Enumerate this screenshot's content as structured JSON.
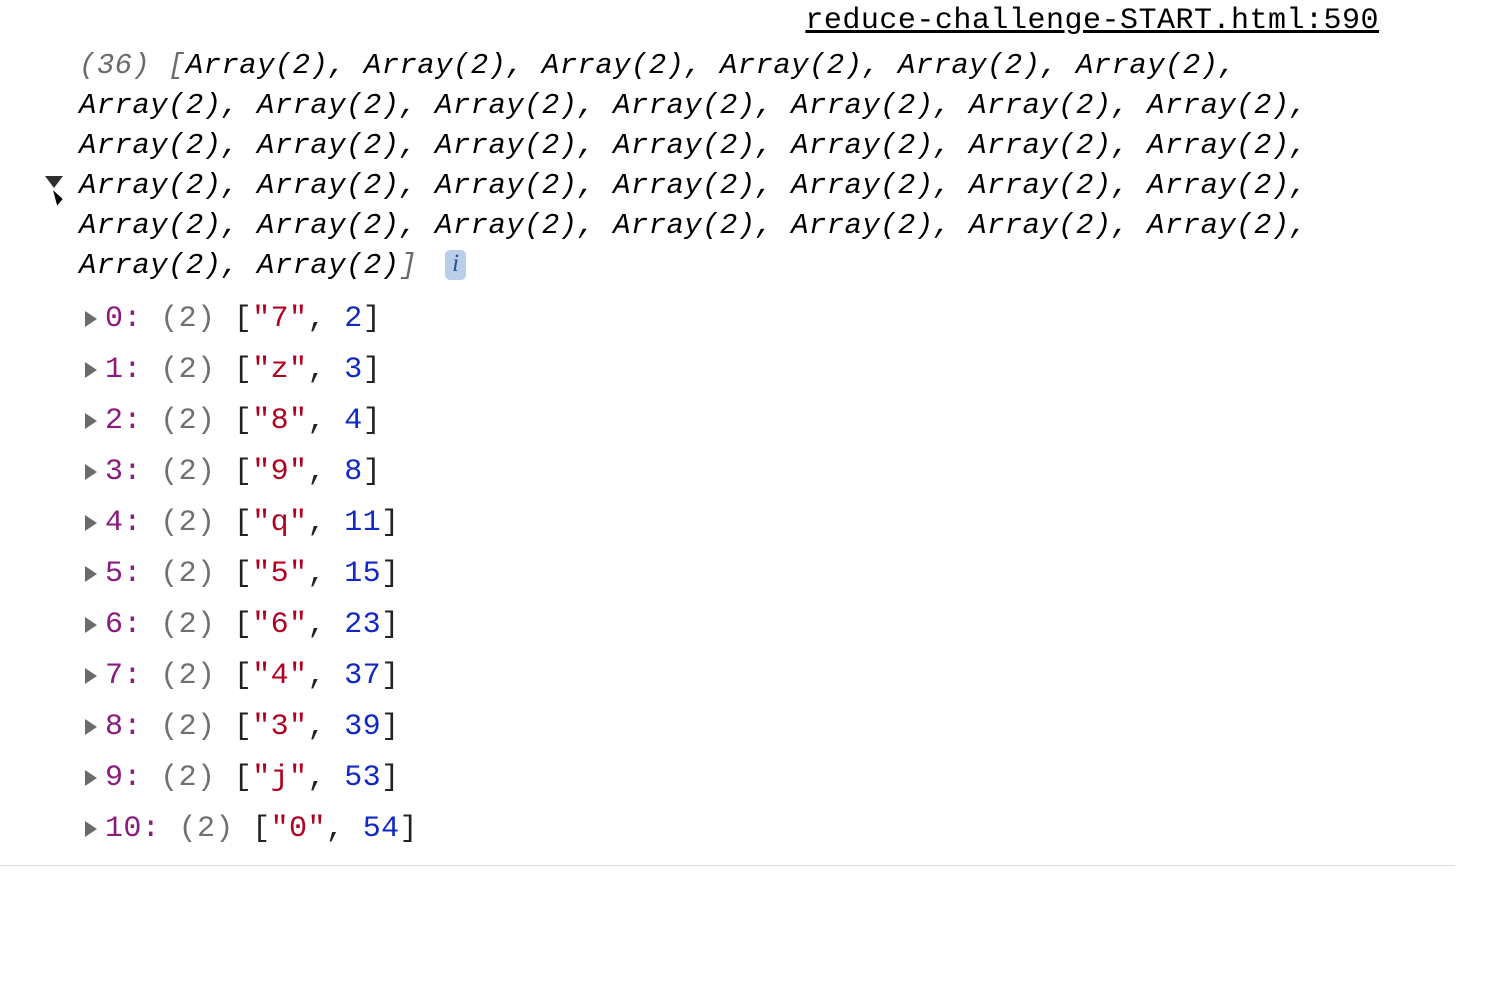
{
  "source": {
    "label": "reduce-challenge-START.html:590"
  },
  "array": {
    "length": 36,
    "item_type": "Array(2)",
    "info_badge": "i"
  },
  "entries": [
    {
      "index": 0,
      "len": 2,
      "key": "7",
      "val": 2
    },
    {
      "index": 1,
      "len": 2,
      "key": "z",
      "val": 3
    },
    {
      "index": 2,
      "len": 2,
      "key": "8",
      "val": 4
    },
    {
      "index": 3,
      "len": 2,
      "key": "9",
      "val": 8
    },
    {
      "index": 4,
      "len": 2,
      "key": "q",
      "val": 11
    },
    {
      "index": 5,
      "len": 2,
      "key": "5",
      "val": 15
    },
    {
      "index": 6,
      "len": 2,
      "key": "6",
      "val": 23
    },
    {
      "index": 7,
      "len": 2,
      "key": "4",
      "val": 37
    },
    {
      "index": 8,
      "len": 2,
      "key": "3",
      "val": 39
    },
    {
      "index": 9,
      "len": 2,
      "key": "j",
      "val": 53
    },
    {
      "index": 10,
      "len": 2,
      "key": "0",
      "val": 54
    }
  ]
}
